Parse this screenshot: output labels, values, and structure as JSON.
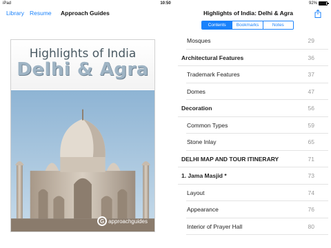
{
  "status_bar": {
    "carrier": "iPad",
    "time": "10:50",
    "battery_percent": "92%",
    "battery_level": 0.92
  },
  "left_nav": {
    "library_label": "Library",
    "resume_label": "Resume",
    "title": "Approach Guides"
  },
  "cover": {
    "title_line1": "Highlights of India",
    "title_line2": "Delhi & Agra",
    "brand_mark": "G",
    "brand_text": "approachguides"
  },
  "right_nav": {
    "title": "Highlights of India: Delhi & Agra",
    "share_icon": "share-icon",
    "tabs": [
      {
        "label": "Contents",
        "active": true
      },
      {
        "label": "Bookmarks",
        "active": false
      },
      {
        "label": "Notes",
        "active": false
      }
    ]
  },
  "toc": [
    {
      "label": "Mosques",
      "page": "29",
      "level": "sub"
    },
    {
      "label": "Architectural Features",
      "page": "36",
      "level": "top"
    },
    {
      "label": "Trademark Features",
      "page": "37",
      "level": "sub"
    },
    {
      "label": "Domes",
      "page": "47",
      "level": "sub"
    },
    {
      "label": "Decoration",
      "page": "56",
      "level": "top"
    },
    {
      "label": "Common Types",
      "page": "59",
      "level": "sub"
    },
    {
      "label": "Stone Inlay",
      "page": "65",
      "level": "sub"
    },
    {
      "label": "DELHI MAP AND TOUR ITINERARY",
      "page": "71",
      "level": "top"
    },
    {
      "label": "1. Jama Masjid *",
      "page": "73",
      "level": "top"
    },
    {
      "label": "Layout",
      "page": "74",
      "level": "sub"
    },
    {
      "label": "Appearance",
      "page": "76",
      "level": "sub"
    },
    {
      "label": "Interior of Prayer Hall",
      "page": "80",
      "level": "sub"
    }
  ]
}
